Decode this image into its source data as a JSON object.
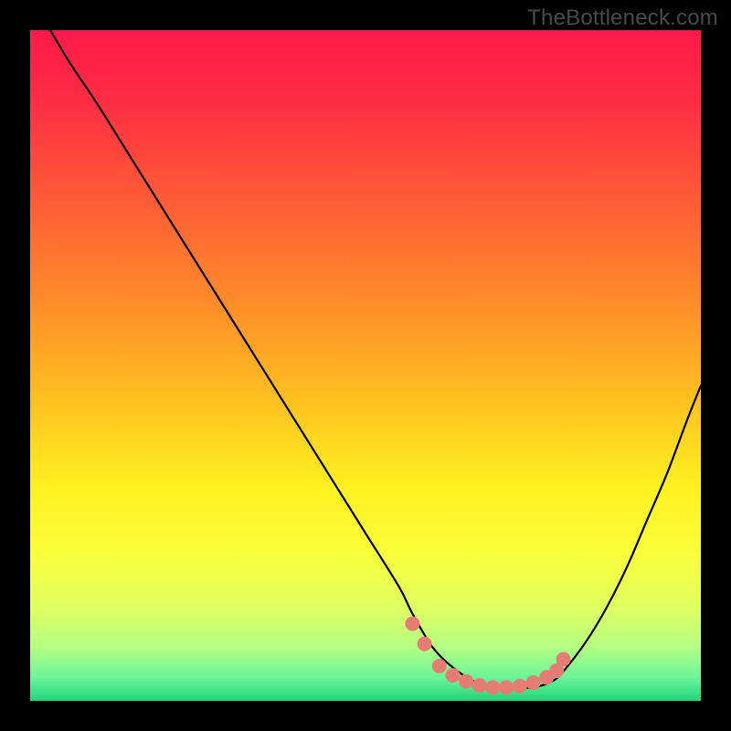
{
  "watermark": "TheBottleneck.com",
  "colors": {
    "background": "#000000",
    "curve": "#000000",
    "dots": "#e77c74",
    "gradient_stops": [
      {
        "offset": 0.0,
        "color": "#ff1a4a"
      },
      {
        "offset": 0.1,
        "color": "#ff2b44"
      },
      {
        "offset": 0.25,
        "color": "#ff5a37"
      },
      {
        "offset": 0.4,
        "color": "#ff8a2a"
      },
      {
        "offset": 0.55,
        "color": "#ffc020"
      },
      {
        "offset": 0.68,
        "color": "#fff020"
      },
      {
        "offset": 0.78,
        "color": "#faff3a"
      },
      {
        "offset": 0.86,
        "color": "#e0ff60"
      },
      {
        "offset": 0.92,
        "color": "#b4ff82"
      },
      {
        "offset": 0.965,
        "color": "#6cf59a"
      },
      {
        "offset": 1.0,
        "color": "#1fd57d"
      }
    ]
  },
  "chart_data": {
    "type": "line",
    "title": "",
    "xlabel": "",
    "ylabel": "",
    "xlim": [
      0,
      100
    ],
    "ylim": [
      0,
      100
    ],
    "grid": false,
    "legend": false,
    "series": [
      {
        "name": "bottleneck-curve",
        "x": [
          3,
          6,
          10,
          15,
          20,
          25,
          30,
          35,
          40,
          45,
          50,
          55,
          57,
          60,
          63,
          66,
          69,
          72,
          75,
          78,
          80,
          83,
          86,
          89,
          92,
          95,
          98,
          100
        ],
        "values": [
          100,
          95,
          89,
          81,
          73,
          65,
          57,
          49,
          41,
          33,
          25,
          17,
          13,
          8,
          5,
          3,
          2,
          2,
          2,
          3,
          5,
          9,
          14,
          20,
          27,
          34,
          42,
          47
        ]
      }
    ],
    "highlight_points": {
      "name": "optimal-range-dots",
      "x": [
        57,
        58.8,
        61,
        63,
        65,
        67,
        69,
        71,
        73,
        75,
        77,
        78.5,
        79.5
      ],
      "values": [
        11.5,
        8.5,
        5.2,
        3.8,
        2.9,
        2.3,
        2.0,
        2.0,
        2.2,
        2.7,
        3.5,
        4.5,
        6.2
      ]
    }
  }
}
